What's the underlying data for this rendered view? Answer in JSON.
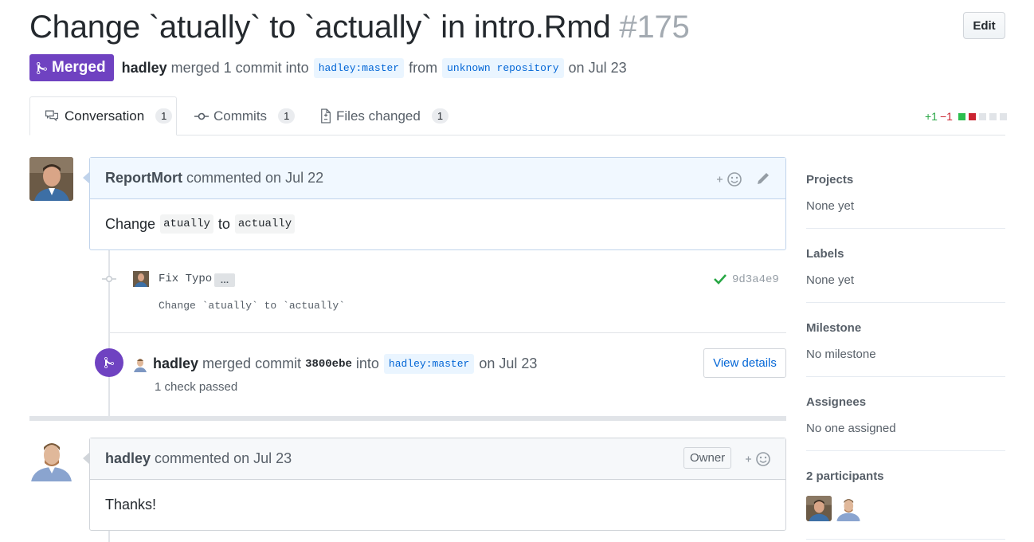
{
  "pr": {
    "title": "Change `atually` to `actually` in intro.Rmd",
    "number": "#175",
    "edit_label": "Edit",
    "status": "Merged",
    "author": "hadley",
    "action": "merged 1 commit into",
    "base_branch": "hadley:master",
    "from_text": "from",
    "head_branch": "unknown repository",
    "date_text": "on Jul 23"
  },
  "tabs": [
    {
      "label": "Conversation",
      "count": "1"
    },
    {
      "label": "Commits",
      "count": "1"
    },
    {
      "label": "Files changed",
      "count": "1"
    }
  ],
  "diffstat": {
    "additions": "+1",
    "deletions": "−1"
  },
  "comment1": {
    "author": "ReportMort",
    "meta": "commented on Jul 22",
    "body_pre": "Change",
    "code1": "atually",
    "body_mid": "to",
    "code2": "actually"
  },
  "commit": {
    "message": "Fix Typo",
    "ellipsis": "…",
    "description": "Change `atually` to `actually`",
    "sha": "9d3a4e9"
  },
  "merge_event": {
    "user": "hadley",
    "text": "merged commit",
    "sha": "3800ebe",
    "into": "into",
    "branch": "hadley:master",
    "date": "on Jul 23",
    "checks": "1 check passed",
    "view_details": "View details"
  },
  "comment2": {
    "author": "hadley",
    "meta": "commented on Jul 23",
    "badge": "Owner",
    "body": "Thanks!"
  },
  "sidebar": {
    "projects_title": "Projects",
    "projects_value": "None yet",
    "labels_title": "Labels",
    "labels_value": "None yet",
    "milestone_title": "Milestone",
    "milestone_value": "No milestone",
    "assignees_title": "Assignees",
    "assignees_value": "No one assigned",
    "participants_title": "2 participants"
  },
  "colors": {
    "merged": "#6f42c1",
    "link": "#0366d6",
    "success": "#28a745",
    "danger": "#cb2431"
  }
}
